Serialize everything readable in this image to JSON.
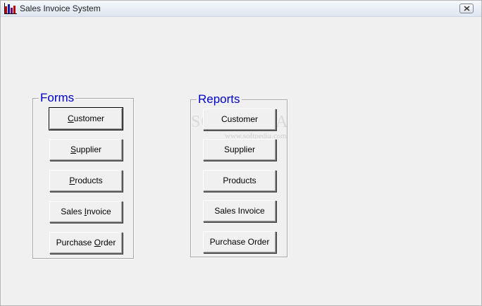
{
  "window": {
    "title": "Sales Invoice System",
    "close_icon": "close-icon",
    "app_icon": "bar-chart-app-icon"
  },
  "forms": {
    "legend": "Forms",
    "buttons": [
      {
        "pre": "",
        "key": "C",
        "post": "ustomer"
      },
      {
        "pre": "",
        "key": "S",
        "post": "upplier"
      },
      {
        "pre": "",
        "key": "P",
        "post": "roducts"
      },
      {
        "pre": "Sales ",
        "key": "I",
        "post": "nvoice"
      },
      {
        "pre": "Purchase ",
        "key": "O",
        "post": "rder"
      }
    ]
  },
  "reports": {
    "legend": "Reports",
    "buttons": [
      {
        "label": "Customer"
      },
      {
        "label": "Supplier"
      },
      {
        "label": "Products"
      },
      {
        "label": "Sales Invoice"
      },
      {
        "label": "Purchase Order"
      }
    ]
  },
  "watermark": {
    "text": "SOFTPEDIA",
    "url": "www.softpedia.com"
  },
  "colors": {
    "legend": "#0000c8",
    "background": "#f0f0f0"
  }
}
